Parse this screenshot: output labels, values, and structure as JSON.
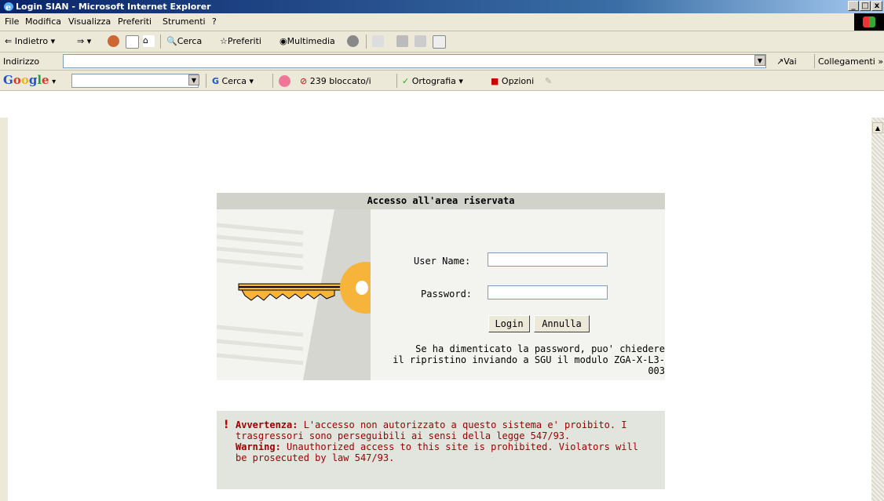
{
  "window": {
    "title": "Login SIAN - Microsoft Internet Explorer",
    "btn_min": "_",
    "btn_max": "□",
    "btn_close": "x"
  },
  "menu": {
    "items": [
      "File",
      "Modifica",
      "Visualizza",
      "Preferiti",
      "Strumenti",
      "?"
    ]
  },
  "toolbar": {
    "back": "Indietro",
    "search": "Cerca",
    "favorites": "Preferiti",
    "media": "Multimedia"
  },
  "address": {
    "label": "Indirizzo",
    "value": "",
    "go": "Vai",
    "links": "Collegamenti"
  },
  "google": {
    "logo": "Google",
    "search": "Cerca",
    "blocked": "239 bloccato/i",
    "spell": "Ortografia",
    "options": "Opzioni"
  },
  "login": {
    "title": "Accesso all'area riservata",
    "username_label": "User Name:",
    "password_label": "Password:",
    "login_button": "Login",
    "cancel_button": "Annulla",
    "forgot_line1": "Se ha dimenticato la password, puo' chiedere",
    "forgot_line2": "il ripristino inviando a SGU il modulo ZGA-X-L3-003"
  },
  "warning": {
    "it_label": "Avvertenza:",
    "it_text": " L'accesso non autorizzato a questo sistema e' proibito. I trasgressori sono perseguibili ai sensi della legge 547/93.",
    "en_label": "Warning:",
    "en_text": " Unauthorized access to this site is prohibited. Violators will be prosecuted by law 547/93."
  },
  "colors": {
    "warning_text": "#a00000",
    "header_bg": "#d1d3cb",
    "key_fill": "#f6b43b"
  }
}
